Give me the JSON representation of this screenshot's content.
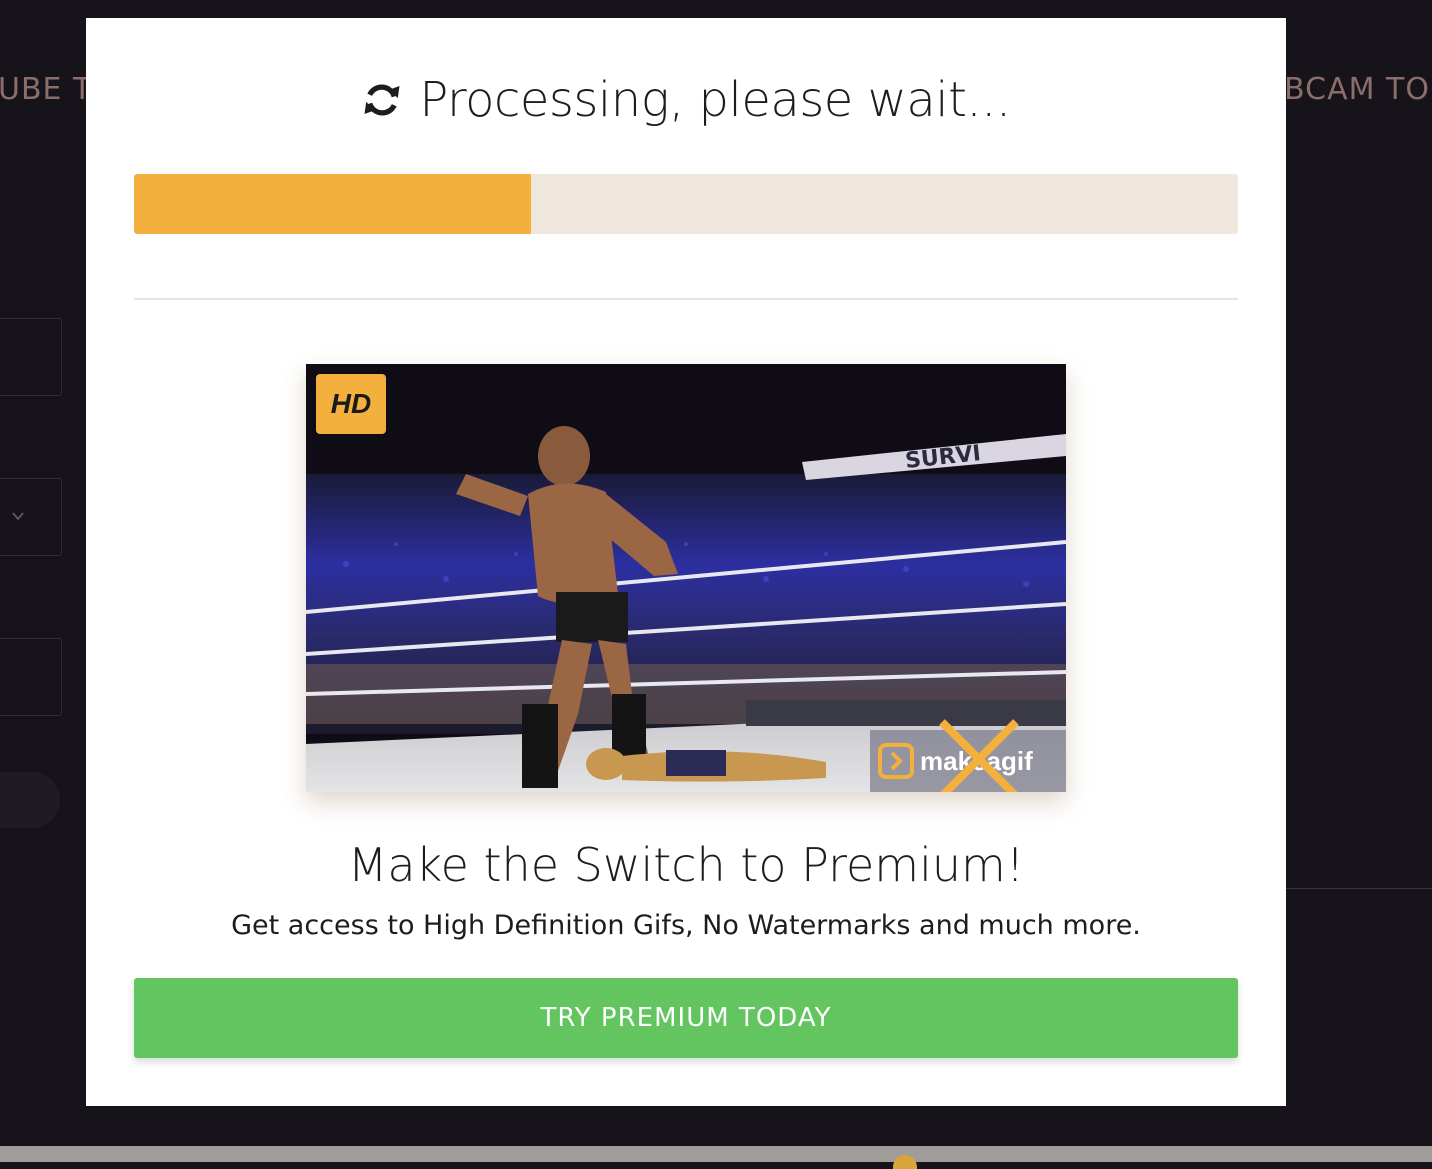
{
  "background": {
    "nav_left_text": "UBE TO",
    "nav_right_text": "EBCAM TO"
  },
  "modal": {
    "icon": "refresh-icon",
    "title": "Processing, please wait...",
    "progress_fraction": 0.36,
    "progress_color": "#f4b03c",
    "preview": {
      "badge_text": "HD",
      "watermark_text": "makeagif",
      "watermark_crossed": true
    },
    "promo_heading": "Make the Switch to Premium!",
    "promo_subtext": "Get access to High Definition Gifs, No Watermarks and much more.",
    "cta_label": "TRY PREMIUM TODAY",
    "cta_color": "#63c560"
  }
}
